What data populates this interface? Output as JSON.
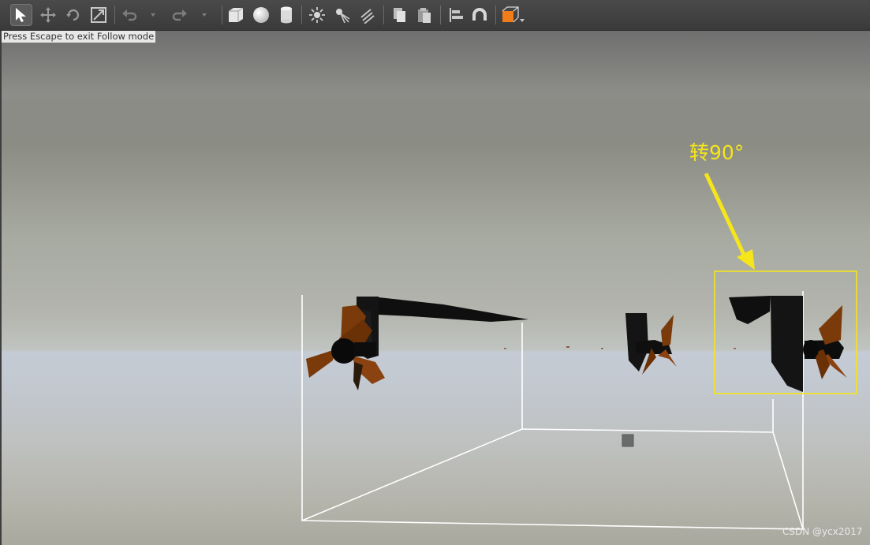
{
  "toolbar": {
    "tools": [
      {
        "id": "select",
        "icon": "arrow-cursor-icon",
        "active": true
      },
      {
        "id": "translate",
        "icon": "move-arrows-icon"
      },
      {
        "id": "rotate",
        "icon": "rotate-icon"
      },
      {
        "id": "scale",
        "icon": "scale-icon"
      },
      {
        "id": "undo",
        "icon": "undo-icon"
      },
      {
        "id": "undo-history",
        "icon": "chevron-down-icon"
      },
      {
        "id": "redo",
        "icon": "redo-icon"
      },
      {
        "id": "redo-history",
        "icon": "chevron-down-icon"
      },
      {
        "id": "box",
        "icon": "box-shape-icon"
      },
      {
        "id": "sphere",
        "icon": "sphere-shape-icon"
      },
      {
        "id": "cylinder",
        "icon": "cylinder-shape-icon"
      },
      {
        "id": "point-light",
        "icon": "point-light-icon"
      },
      {
        "id": "spot-light",
        "icon": "spot-light-icon"
      },
      {
        "id": "directional-light",
        "icon": "directional-light-icon"
      },
      {
        "id": "copy",
        "icon": "copy-icon"
      },
      {
        "id": "paste",
        "icon": "paste-icon"
      },
      {
        "id": "align",
        "icon": "align-icon"
      },
      {
        "id": "snap",
        "icon": "magnet-snap-icon"
      },
      {
        "id": "view-angle",
        "icon": "view-angle-cube-icon"
      }
    ],
    "accent_color": "#f07c1a"
  },
  "status_tip": "Press Escape to exit Follow mode",
  "annotation": {
    "text": "转90°",
    "color": "#f5e51a"
  },
  "watermark": "CSDN @ycx2017",
  "scene": {
    "sky_color": "#8c8c88",
    "ground_color": "#c5cbd4",
    "propeller_color": "#7a3a0a",
    "rudder_color": "#111111",
    "bounding_box_color": "#ffffff"
  }
}
